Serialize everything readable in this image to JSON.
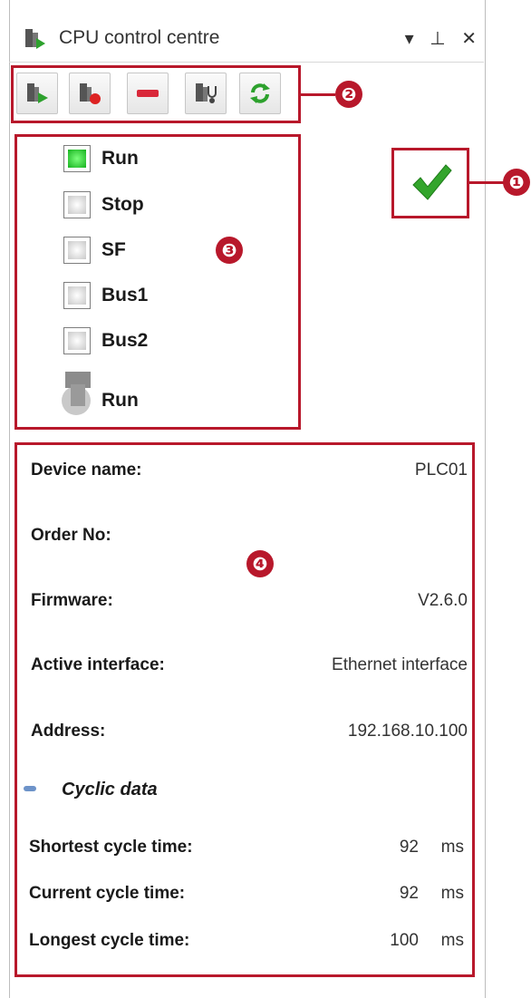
{
  "window": {
    "title": "CPU control centre",
    "controls": {
      "menu": "▾",
      "pin": "ᵖ",
      "close": "✕"
    }
  },
  "toolbar": {
    "buttons": [
      {
        "name": "run-cpu-button",
        "icon": "cpu-start-icon"
      },
      {
        "name": "stop-cpu-button",
        "icon": "cpu-stop-icon"
      },
      {
        "name": "remove-button",
        "icon": "minus-icon"
      },
      {
        "name": "diagnostics-button",
        "icon": "device-diagnostics-icon"
      },
      {
        "name": "refresh-button",
        "icon": "refresh-icon"
      }
    ]
  },
  "status_indicator": {
    "icon": "checkmark-icon",
    "color": "#33a52c"
  },
  "callouts": [
    "❶",
    "❷",
    "❸",
    "❹"
  ],
  "leds": [
    {
      "label": "Run",
      "on": true
    },
    {
      "label": "Stop",
      "on": false
    },
    {
      "label": "SF",
      "on": false
    },
    {
      "label": "Bus1",
      "on": false
    },
    {
      "label": "Bus2",
      "on": false
    }
  ],
  "mode_switch": {
    "label": "Run",
    "icon": "key-switch-icon"
  },
  "device_info": [
    {
      "key": "Device name:",
      "value": "PLC01"
    },
    {
      "key": "Order No:",
      "value": ""
    },
    {
      "key": "Firmware:",
      "value": "V2.6.0"
    },
    {
      "key": "Active interface:",
      "value": "Ethernet interface"
    },
    {
      "key": "Address:",
      "value": "192.168.10.100"
    }
  ],
  "cyclic": {
    "header": "Cyclic data",
    "rows": [
      {
        "key": "Shortest cycle time:",
        "value": "92",
        "unit": "ms"
      },
      {
        "key": "Current cycle time:",
        "value": "92",
        "unit": "ms"
      },
      {
        "key": "Longest cycle time:",
        "value": "100",
        "unit": "ms"
      }
    ]
  },
  "colors": {
    "accent_red": "#b8182b",
    "led_on": "#16b11e"
  }
}
